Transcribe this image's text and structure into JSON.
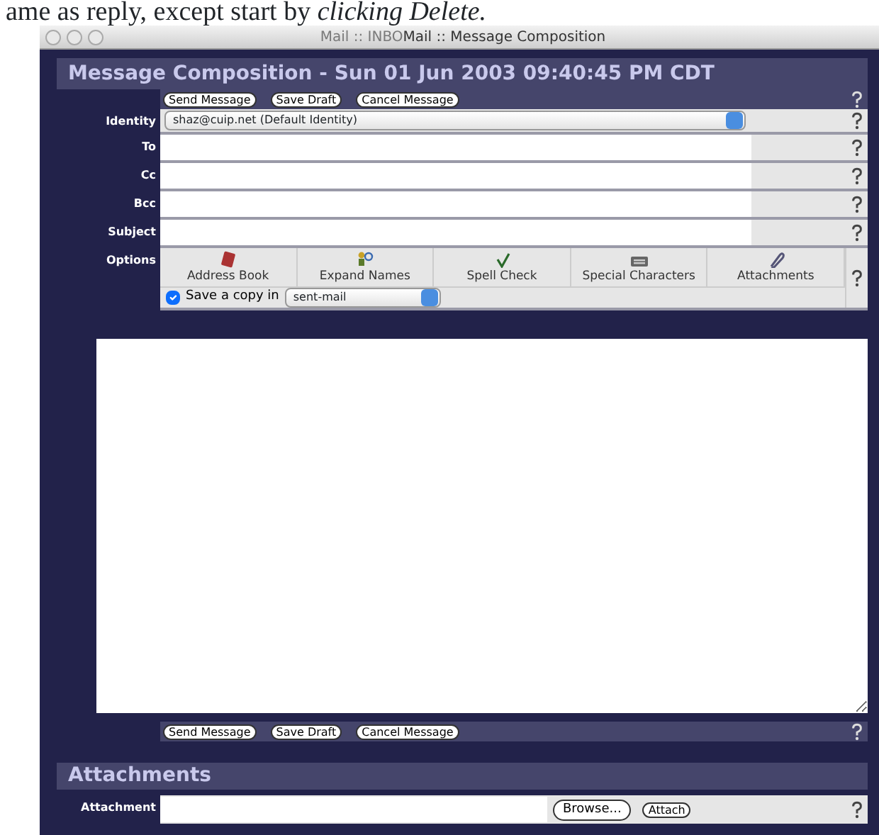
{
  "doc_caption": "ame as reply, except start by *clicking Delete.*",
  "window": {
    "title": "Mail :: Message Composition",
    "background_tab": "Mail :: INBO"
  },
  "heading": "Message Composition - Sun 01 Jun 2003 09:40:45 PM CDT",
  "top_actions": [
    "Send Message",
    "Save Draft",
    "Cancel Message"
  ],
  "fields": [
    {
      "label": "Identity",
      "kind": "select",
      "value": "shaz@cuip.net (Default Identity)"
    },
    {
      "label": "To",
      "kind": "text"
    },
    {
      "label": "Cc",
      "kind": "text"
    },
    {
      "label": "Bcc",
      "kind": "text"
    },
    {
      "label": "Subject",
      "kind": "text"
    }
  ],
  "options": {
    "label": "Options",
    "tools": [
      {
        "label": "Address Book",
        "kind": "book"
      },
      {
        "label": "Expand Names",
        "kind": "people"
      },
      {
        "label": "Spell Check",
        "kind": "spell"
      },
      {
        "label": "Special Characters",
        "kind": "keyboard"
      },
      {
        "label": "Attachments",
        "kind": "clip"
      }
    ],
    "save_copy": {
      "label": "Save a copy in",
      "checked": true,
      "folder": "sent-mail"
    }
  },
  "bottom_actions": [
    "Send Message",
    "Save Draft",
    "Cancel Message"
  ],
  "attachments": {
    "heading": "Attachments",
    "label": "Attachment",
    "browse": "Browse...",
    "attach": "Attach"
  }
}
